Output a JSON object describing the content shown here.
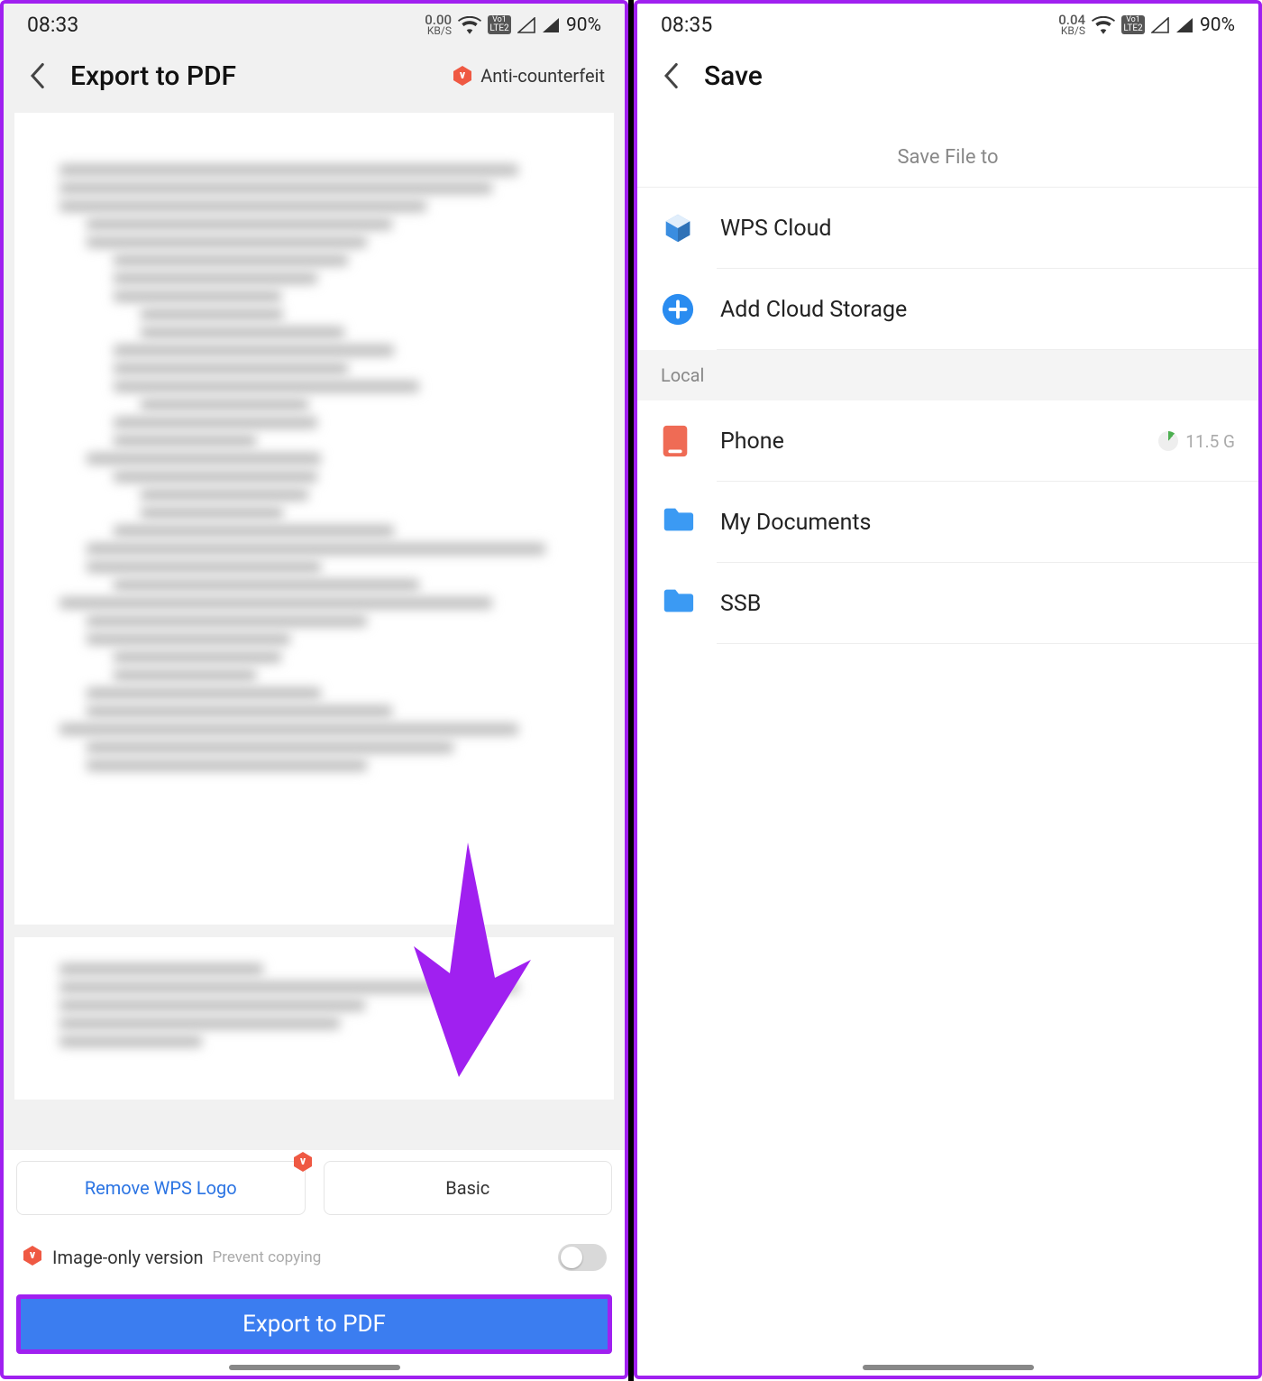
{
  "left": {
    "status": {
      "time": "08:33",
      "kbs": "0.00",
      "kbs_unit": "KB/S",
      "volte": "VoLTE",
      "battery": "90%"
    },
    "header": {
      "title": "Export to PDF",
      "anti": "Anti-counterfeit"
    },
    "options": {
      "remove_logo": "Remove WPS Logo",
      "basic": "Basic"
    },
    "image_only": {
      "label": "Image-only version",
      "sub": "Prevent copying"
    },
    "export_button": "Export to PDF"
  },
  "right": {
    "status": {
      "time": "08:35",
      "kbs": "0.04",
      "kbs_unit": "KB/S",
      "volte": "VoLTE",
      "battery": "90%"
    },
    "header": {
      "title": "Save"
    },
    "subtitle": "Save File to",
    "section_local": "Local",
    "items": {
      "wps_cloud": "WPS Cloud",
      "add_cloud": "Add Cloud Storage",
      "phone": "Phone",
      "phone_size": "11.5 G",
      "my_docs": "My Documents",
      "ssb": "SSB"
    }
  }
}
